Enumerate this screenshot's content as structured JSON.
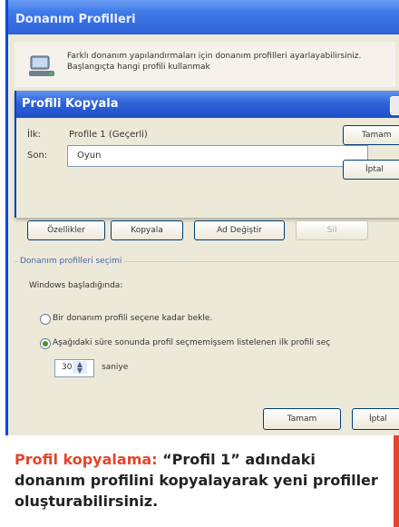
{
  "back_window": {
    "title": "Donanım Profilleri",
    "intro_text": "Farklı donanım yapılandırmaları için donanım profilleri ayarlayabilirsiniz. Başlangıçta hangi profili kullanmak"
  },
  "copy_dialog": {
    "title": "Profili Kopyala",
    "from_label": "İlk:",
    "from_value": "Profile 1 (Geçerli)",
    "to_label": "Son:",
    "to_value": "Oyun",
    "ok_label": "Tamam",
    "cancel_label": "İptal"
  },
  "profile_buttons": {
    "properties": "Özellikler",
    "copy": "Kopyala",
    "rename": "Ad Değiştir",
    "delete": "Sil"
  },
  "selection_group": {
    "title": "Donanım profilleri seçimi",
    "subtitle": "Windows başladığında:",
    "option_wait": "Bir donanım profili seçene kadar bekle.",
    "option_timeout": "Aşağıdaki süre sonunda profil seçmemişsem listelenen ilk profili seç",
    "selected_option": "timeout",
    "seconds_value": "30",
    "seconds_unit": "saniye"
  },
  "footer_buttons": {
    "ok": "Tamam",
    "cancel": "İptal"
  },
  "caption": {
    "lead": "Profil kopyalama:",
    "body": " “Profil 1” adındaki donanım profilini kopyalayarak yeni profiller oluşturabilirsiniz."
  },
  "colors": {
    "accent": "#e2462b",
    "titlebar": "#2e63d8",
    "dialog_bg": "#ece9d8"
  }
}
